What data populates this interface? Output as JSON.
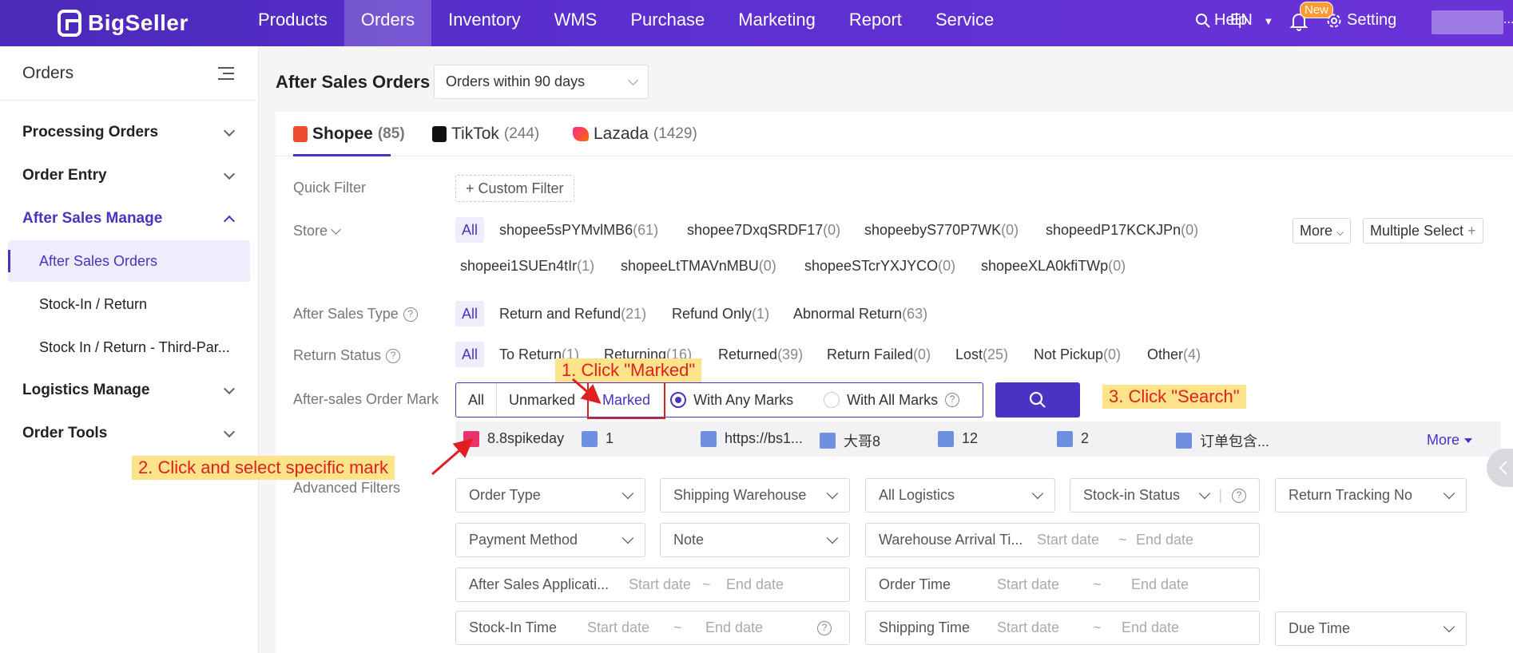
{
  "nav": {
    "brand": "BigSeller",
    "items": [
      "Products",
      "Orders",
      "Inventory",
      "WMS",
      "Purchase",
      "Marketing",
      "Report",
      "Service"
    ],
    "help": "Help",
    "lang": "EN",
    "badge": "New",
    "setting": "Setting",
    "more": "..."
  },
  "sidebar": {
    "title": "Orders",
    "sections": [
      "Processing Orders",
      "Order Entry",
      "After Sales Manage",
      "Logistics Manage",
      "Order Tools"
    ],
    "sub_items": [
      "After Sales Orders",
      "Stock-In / Return",
      "Stock In / Return - Third-Par..."
    ]
  },
  "header": {
    "title": "After Sales Orders",
    "range": "Orders within 90 days"
  },
  "tabs": [
    {
      "label": "Shopee",
      "count": "(85)"
    },
    {
      "label": "TikTok",
      "count": "(244)"
    },
    {
      "label": "Lazada",
      "count": "(1429)"
    }
  ],
  "filters": {
    "quick_filter": "Quick Filter",
    "custom_filter": "+ Custom Filter",
    "store_label": "Store",
    "all": "All",
    "stores": [
      {
        "name": "shopee5sPYMvlMB6",
        "count": "(61)"
      },
      {
        "name": "shopee7DxqSRDF17",
        "count": "(0)"
      },
      {
        "name": "shopeebyS770P7WK",
        "count": "(0)"
      },
      {
        "name": "shopeedP17KCKJPn",
        "count": "(0)"
      },
      {
        "name": "shopeei1SUEn4tIr",
        "count": "(1)"
      },
      {
        "name": "shopeeLtTMAVnMBU",
        "count": "(0)"
      },
      {
        "name": "shopeeSTcrYXJYCO",
        "count": "(0)"
      },
      {
        "name": "shopeeXLA0kfiTWp",
        "count": "(0)"
      }
    ],
    "more_btn": "More",
    "multi_select": "Multiple Select",
    "after_sales_type_label": "After Sales Type",
    "after_sales_types": [
      {
        "name": "Return and Refund",
        "count": "(21)"
      },
      {
        "name": "Refund Only",
        "count": "(1)"
      },
      {
        "name": "Abnormal Return",
        "count": "(63)"
      }
    ],
    "return_status_label": "Return Status",
    "return_statuses": [
      {
        "name": "To Return",
        "count": "(1)"
      },
      {
        "name": "Returning",
        "count": "(16)"
      },
      {
        "name": "Returned",
        "count": "(39)"
      },
      {
        "name": "Return Failed",
        "count": "(0)"
      },
      {
        "name": "Lost",
        "count": "(25)"
      },
      {
        "name": "Not Pickup",
        "count": "(0)"
      },
      {
        "name": "Other",
        "count": "(4)"
      }
    ],
    "mark_label": "After-sales Order Mark",
    "mark_options": [
      "All",
      "Unmarked",
      "Marked"
    ],
    "with_any": "With Any Marks",
    "with_all": "With All Marks",
    "marks": [
      {
        "name": "8.8spikeday",
        "color": "#e8336b"
      },
      {
        "name": "1",
        "color": "#6f8fe0"
      },
      {
        "name": "https://bs1...",
        "color": "#6f8fe0"
      },
      {
        "name": "大哥8",
        "color": "#6f8fe0"
      },
      {
        "name": "12",
        "color": "#6f8fe0"
      },
      {
        "name": "2",
        "color": "#6f8fe0"
      },
      {
        "name": "订单包含...",
        "color": "#6f8fe0"
      }
    ],
    "marks_more": "More",
    "advanced_label": "Advanced Filters",
    "advanced": {
      "order_type": "Order Type",
      "shipping_warehouse": "Shipping Warehouse",
      "all_logistics": "All Logistics",
      "stock_in_status": "Stock-in Status",
      "return_tracking": "Return Tracking No",
      "payment_method": "Payment Method",
      "note": "Note",
      "warehouse_arrival": "Warehouse Arrival Ti...",
      "after_sales_app": "After Sales Applicati...",
      "order_time": "Order Time",
      "stock_in_time": "Stock-In Time",
      "shipping_time": "Shipping Time",
      "due_time": "Due Time",
      "start_date": "Start date",
      "end_date": "End date",
      "tilde": "~"
    }
  },
  "annotations": {
    "step1": "1. Click \"Marked\"",
    "step2": "2. Click and select specific mark",
    "step3": "3. Click \"Search\""
  },
  "colors": {
    "accent": "#4b32c3",
    "annotation_red": "#e02020",
    "annotation_bg": "#fde38a"
  }
}
